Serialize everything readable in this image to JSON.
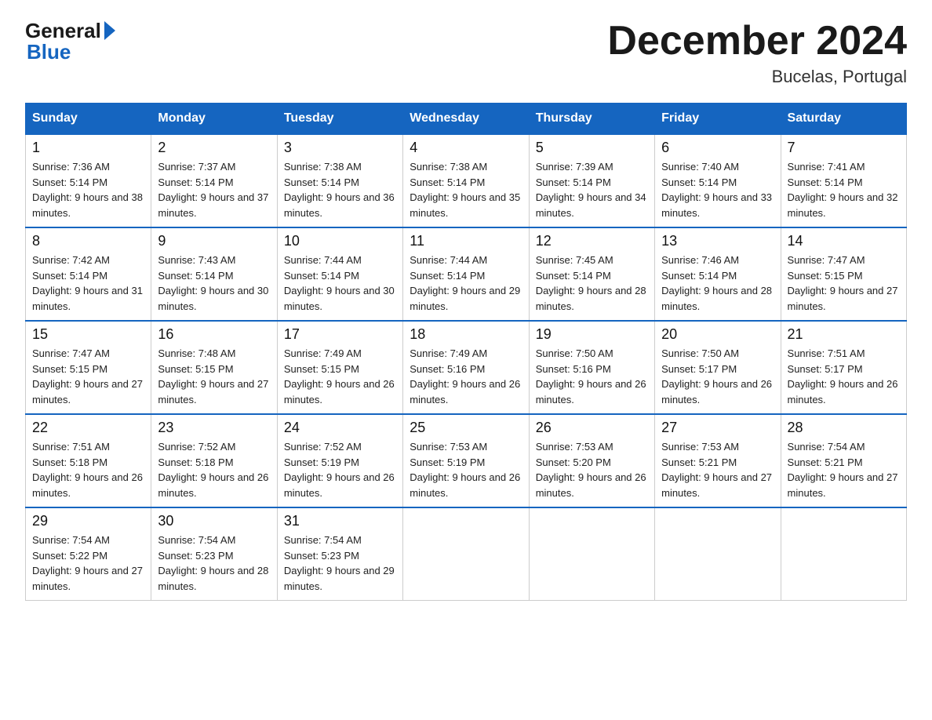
{
  "header": {
    "logo_general": "General",
    "logo_blue": "Blue",
    "month_year": "December 2024",
    "location": "Bucelas, Portugal"
  },
  "columns": [
    "Sunday",
    "Monday",
    "Tuesday",
    "Wednesday",
    "Thursday",
    "Friday",
    "Saturday"
  ],
  "weeks": [
    [
      {
        "day": "1",
        "sunrise": "7:36 AM",
        "sunset": "5:14 PM",
        "daylight": "9 hours and 38 minutes."
      },
      {
        "day": "2",
        "sunrise": "7:37 AM",
        "sunset": "5:14 PM",
        "daylight": "9 hours and 37 minutes."
      },
      {
        "day": "3",
        "sunrise": "7:38 AM",
        "sunset": "5:14 PM",
        "daylight": "9 hours and 36 minutes."
      },
      {
        "day": "4",
        "sunrise": "7:38 AM",
        "sunset": "5:14 PM",
        "daylight": "9 hours and 35 minutes."
      },
      {
        "day": "5",
        "sunrise": "7:39 AM",
        "sunset": "5:14 PM",
        "daylight": "9 hours and 34 minutes."
      },
      {
        "day": "6",
        "sunrise": "7:40 AM",
        "sunset": "5:14 PM",
        "daylight": "9 hours and 33 minutes."
      },
      {
        "day": "7",
        "sunrise": "7:41 AM",
        "sunset": "5:14 PM",
        "daylight": "9 hours and 32 minutes."
      }
    ],
    [
      {
        "day": "8",
        "sunrise": "7:42 AM",
        "sunset": "5:14 PM",
        "daylight": "9 hours and 31 minutes."
      },
      {
        "day": "9",
        "sunrise": "7:43 AM",
        "sunset": "5:14 PM",
        "daylight": "9 hours and 30 minutes."
      },
      {
        "day": "10",
        "sunrise": "7:44 AM",
        "sunset": "5:14 PM",
        "daylight": "9 hours and 30 minutes."
      },
      {
        "day": "11",
        "sunrise": "7:44 AM",
        "sunset": "5:14 PM",
        "daylight": "9 hours and 29 minutes."
      },
      {
        "day": "12",
        "sunrise": "7:45 AM",
        "sunset": "5:14 PM",
        "daylight": "9 hours and 28 minutes."
      },
      {
        "day": "13",
        "sunrise": "7:46 AM",
        "sunset": "5:14 PM",
        "daylight": "9 hours and 28 minutes."
      },
      {
        "day": "14",
        "sunrise": "7:47 AM",
        "sunset": "5:15 PM",
        "daylight": "9 hours and 27 minutes."
      }
    ],
    [
      {
        "day": "15",
        "sunrise": "7:47 AM",
        "sunset": "5:15 PM",
        "daylight": "9 hours and 27 minutes."
      },
      {
        "day": "16",
        "sunrise": "7:48 AM",
        "sunset": "5:15 PM",
        "daylight": "9 hours and 27 minutes."
      },
      {
        "day": "17",
        "sunrise": "7:49 AM",
        "sunset": "5:15 PM",
        "daylight": "9 hours and 26 minutes."
      },
      {
        "day": "18",
        "sunrise": "7:49 AM",
        "sunset": "5:16 PM",
        "daylight": "9 hours and 26 minutes."
      },
      {
        "day": "19",
        "sunrise": "7:50 AM",
        "sunset": "5:16 PM",
        "daylight": "9 hours and 26 minutes."
      },
      {
        "day": "20",
        "sunrise": "7:50 AM",
        "sunset": "5:17 PM",
        "daylight": "9 hours and 26 minutes."
      },
      {
        "day": "21",
        "sunrise": "7:51 AM",
        "sunset": "5:17 PM",
        "daylight": "9 hours and 26 minutes."
      }
    ],
    [
      {
        "day": "22",
        "sunrise": "7:51 AM",
        "sunset": "5:18 PM",
        "daylight": "9 hours and 26 minutes."
      },
      {
        "day": "23",
        "sunrise": "7:52 AM",
        "sunset": "5:18 PM",
        "daylight": "9 hours and 26 minutes."
      },
      {
        "day": "24",
        "sunrise": "7:52 AM",
        "sunset": "5:19 PM",
        "daylight": "9 hours and 26 minutes."
      },
      {
        "day": "25",
        "sunrise": "7:53 AM",
        "sunset": "5:19 PM",
        "daylight": "9 hours and 26 minutes."
      },
      {
        "day": "26",
        "sunrise": "7:53 AM",
        "sunset": "5:20 PM",
        "daylight": "9 hours and 26 minutes."
      },
      {
        "day": "27",
        "sunrise": "7:53 AM",
        "sunset": "5:21 PM",
        "daylight": "9 hours and 27 minutes."
      },
      {
        "day": "28",
        "sunrise": "7:54 AM",
        "sunset": "5:21 PM",
        "daylight": "9 hours and 27 minutes."
      }
    ],
    [
      {
        "day": "29",
        "sunrise": "7:54 AM",
        "sunset": "5:22 PM",
        "daylight": "9 hours and 27 minutes."
      },
      {
        "day": "30",
        "sunrise": "7:54 AM",
        "sunset": "5:23 PM",
        "daylight": "9 hours and 28 minutes."
      },
      {
        "day": "31",
        "sunrise": "7:54 AM",
        "sunset": "5:23 PM",
        "daylight": "9 hours and 29 minutes."
      },
      null,
      null,
      null,
      null
    ]
  ]
}
